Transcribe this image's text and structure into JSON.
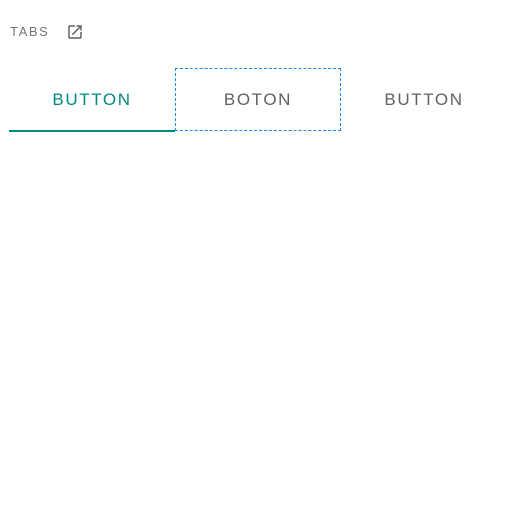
{
  "section": {
    "title": "TABS",
    "external_link_icon": "open-in-new-icon"
  },
  "tabs": [
    {
      "label": "BUTTON",
      "selected": true,
      "focused": false
    },
    {
      "label": "BOTON",
      "selected": false,
      "focused": true
    },
    {
      "label": "BUTTON",
      "selected": false,
      "focused": false
    }
  ],
  "colors": {
    "accent": "#00897b",
    "focus_outline": "#1e88e5",
    "tab_text": "#616161",
    "section_title": "#757575"
  }
}
